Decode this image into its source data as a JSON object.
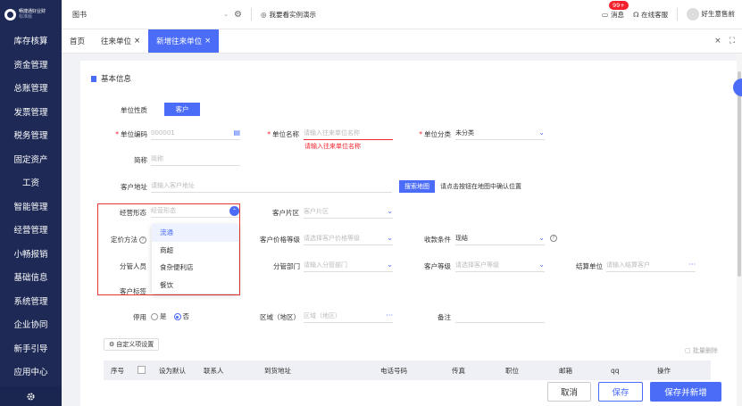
{
  "sidebar": {
    "logo_text_1": "畅捷通好业财",
    "logo_text_2": "标准版",
    "items": [
      {
        "label": "库存核算"
      },
      {
        "label": "资金管理"
      },
      {
        "label": "总账管理"
      },
      {
        "label": "发票管理"
      },
      {
        "label": "税务管理"
      },
      {
        "label": "固定资产"
      },
      {
        "label": "工资"
      },
      {
        "label": "智能管理"
      },
      {
        "label": "经营管理"
      },
      {
        "label": "小畅报销"
      },
      {
        "label": "基础信息"
      },
      {
        "label": "系统管理"
      },
      {
        "label": "企业协同"
      },
      {
        "label": "新手引导"
      },
      {
        "label": "应用中心"
      }
    ]
  },
  "topbar": {
    "search_type": "图书",
    "demo_link": "我要看实例演示",
    "messages_label": "消息",
    "messages_badge": "99+",
    "online_service": "在线客服",
    "user_name": "好生意售前"
  },
  "tabs": [
    {
      "label": "首页",
      "active": false,
      "closable": false
    },
    {
      "label": "往来单位",
      "active": false,
      "closable": true
    },
    {
      "label": "新增往来单位",
      "active": true,
      "closable": true
    }
  ],
  "form": {
    "section_title": "基本信息",
    "unit_type_label": "单位性质",
    "unit_type_value": "客户",
    "code_label": "单位编码",
    "code_value": "000001",
    "name_label": "单位名称",
    "name_placeholder": "请输入往来单位名称",
    "name_error": "请输入往来单位名称",
    "category_label": "单位分类",
    "category_value": "未分类",
    "short_label": "简称",
    "short_placeholder": "简称",
    "address_label": "客户地址",
    "address_placeholder": "请输入客户地址",
    "map_button": "搜索地图",
    "map_hint": "请点击按钮在地图中确认位置",
    "business_form_label": "经营形态",
    "business_form_placeholder": "经营形态",
    "region_label": "客户片区",
    "region_placeholder": "客户片区",
    "pricing_label": "定价方法",
    "price_level_label": "客户价格等级",
    "price_level_placeholder": "请选择客户价格等级",
    "collect_label": "收款条件",
    "collect_value": "现结",
    "staff_label": "分管人员",
    "dept_label": "分管部门",
    "dept_placeholder": "请输入分管部门",
    "grade_label": "客户等级",
    "grade_placeholder": "请选择客户等级",
    "settle_label": "结算单位",
    "settle_placeholder": "请输入结算客户",
    "tag_label": "客户标签",
    "disabled_label": "停用",
    "disabled_yes": "是",
    "disabled_no": "否",
    "disabled_value": "否",
    "area_label": "区域（地区）",
    "area_placeholder": "区域（地区）",
    "remark_label": "备注",
    "custom_button": "自定义项设置",
    "batch_delete": "批量删除"
  },
  "dropdown": {
    "options": [
      "流通",
      "商超",
      "食杂便利店",
      "餐饮"
    ],
    "highlighted": "流通"
  },
  "table": {
    "headers": [
      "序号",
      "",
      "设为默认",
      "联系人",
      "到货地址",
      "电话号码",
      "传真",
      "职位",
      "邮箱",
      "qq",
      "操作"
    ]
  },
  "footer": {
    "cancel": "取消",
    "save": "保存",
    "save_new": "保存并新增"
  },
  "colors": {
    "primary": "#4a6cf7",
    "sidebar": "#1e2a55",
    "error": "#f5222d",
    "highlight_box": "#e53935"
  }
}
